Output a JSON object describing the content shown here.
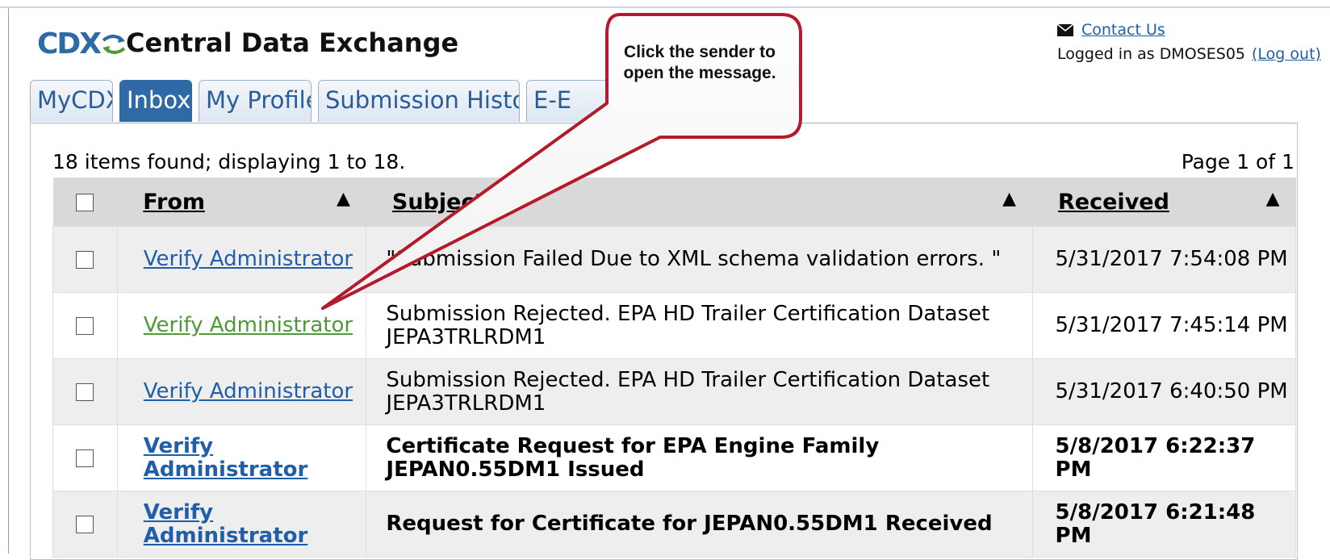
{
  "header": {
    "logo_text": "CDX",
    "title": "Central Data Exchange",
    "contact_label": "Contact Us",
    "logged_in_text": "Logged in as DMOSES05",
    "logout_label": "(Log out)"
  },
  "tabs": [
    {
      "label": "MyCDX"
    },
    {
      "label": "Inbox",
      "active": true
    },
    {
      "label": "My Profile"
    },
    {
      "label": "Submission History"
    },
    {
      "label": "E-E"
    }
  ],
  "inbox": {
    "count_text": "18 items found; displaying 1 to 18.",
    "page_text": "Page 1 of 1",
    "columns": {
      "from": "From",
      "subject": "Subject",
      "received": "Received"
    },
    "rows": [
      {
        "from": "Verify Administrator",
        "subject": "\"Submission Failed Due to XML schema validation errors. \"",
        "received": "5/31/2017 7:54:08 PM",
        "unread": false,
        "visited": false
      },
      {
        "from": "Verify Administrator",
        "subject": "Submission Rejected. EPA HD Trailer Certification Dataset JEPA3TRLRDM1",
        "received": "5/31/2017 7:45:14 PM",
        "unread": false,
        "visited": true
      },
      {
        "from": "Verify Administrator",
        "subject": "Submission Rejected. EPA HD Trailer Certification Dataset JEPA3TRLRDM1",
        "received": "5/31/2017 6:40:50 PM",
        "unread": false,
        "visited": false
      },
      {
        "from": "Verify Administrator",
        "subject": "Certificate Request for EPA Engine Family JEPAN0.55DM1 Issued",
        "received": "5/8/2017 6:22:37 PM",
        "unread": true,
        "visited": false
      },
      {
        "from": "Verify Administrator",
        "subject": "Request for Certificate for JEPAN0.55DM1 Received",
        "received": "5/8/2017 6:21:48 PM",
        "unread": true,
        "visited": false
      }
    ]
  },
  "callout": {
    "text": "Click the sender to open the message."
  },
  "colors": {
    "brand_blue": "#2f6aa7",
    "link_blue": "#1f5ea8",
    "visited_green": "#4e9a38",
    "callout_border": "#b31b2c"
  }
}
